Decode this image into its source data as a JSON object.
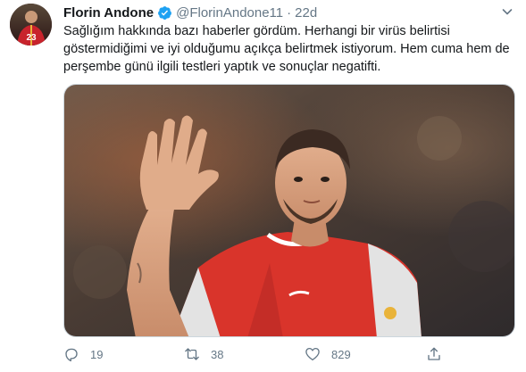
{
  "tweet": {
    "author_name": "Florin Andone",
    "handle": "@FlorinAndone11",
    "separator": "·",
    "time": "22d",
    "text": "Sağlığım hakkında bazı haberler gördüm. Herhangi bir virüs belirtisi göstermidiğimi ve iyi olduğumu açıkça belirtmek istiyorum. Hem cuma hem de perşembe günü ilgili testleri yaptık ve sonuçlar negatifti.",
    "avatar_number": "23"
  },
  "actions": {
    "reply_count": "19",
    "retweet_count": "38",
    "like_count": "829"
  },
  "icons": {
    "verified": "verified-badge-icon",
    "caret": "chevron-down-icon",
    "reply": "reply-icon",
    "retweet": "retweet-icon",
    "like": "heart-icon",
    "share": "share-icon"
  },
  "colors": {
    "accent": "#1da1f2",
    "muted": "#657786",
    "jersey_red": "#d9342b"
  }
}
